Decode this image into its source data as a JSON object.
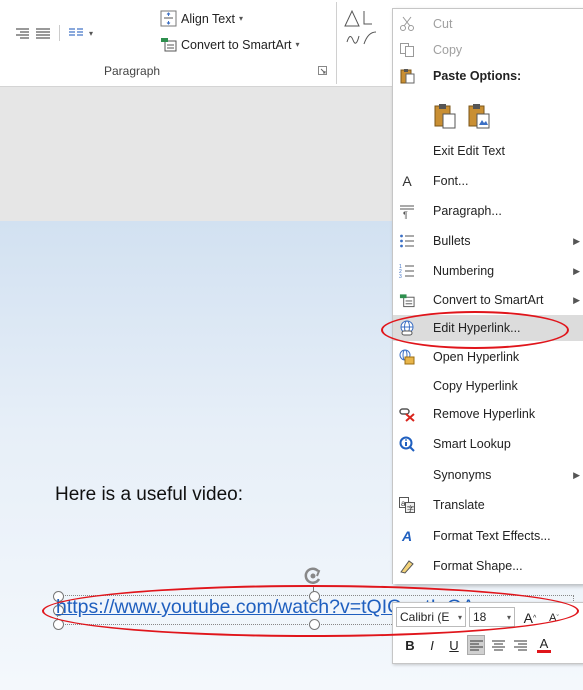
{
  "ribbon": {
    "align_text_label": "Align Text",
    "convert_smartart_label": "Convert to SmartArt",
    "group_label": "Paragraph"
  },
  "slide": {
    "body_text": "Here is a useful video:",
    "hyperlink_text": "https://www.youtube.com/watch?v=tQICwstInOA"
  },
  "menu": {
    "cut": "Cut",
    "copy": "Copy",
    "paste_options": "Paste Options:",
    "exit_edit_text": "Exit Edit Text",
    "font": "Font...",
    "paragraph": "Paragraph...",
    "bullets": "Bullets",
    "numbering": "Numbering",
    "convert_smartart": "Convert to SmartArt",
    "edit_hyperlink": "Edit Hyperlink...",
    "open_hyperlink": "Open Hyperlink",
    "copy_hyperlink": "Copy Hyperlink",
    "remove_hyperlink": "Remove Hyperlink",
    "smart_lookup": "Smart Lookup",
    "synonyms": "Synonyms",
    "translate": "Translate",
    "format_text_effects": "Format Text Effects...",
    "format_shape": "Format Shape..."
  },
  "mini_toolbar": {
    "font_name": "Calibri (E",
    "font_size": "18",
    "grow_font": "A",
    "shrink_font": "A",
    "bold": "B",
    "italic": "I",
    "underline": "U",
    "font_color": "A"
  },
  "colors": {
    "hyperlink": "#1f5fbf",
    "annotation_red": "#e0151b",
    "menu_highlight": "#dcdcdc"
  }
}
